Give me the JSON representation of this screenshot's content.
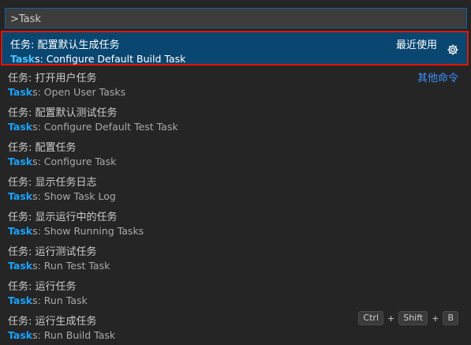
{
  "search": {
    "value": ">Task"
  },
  "items": [
    {
      "line1": "任务: 配置默认生成任务",
      "hl": "Task",
      "rest": "s: Configure Default Build Task",
      "right": "最近使用"
    },
    {
      "line1": "任务: 打开用户任务",
      "hl": "Task",
      "rest": "s: Open User Tasks",
      "right": "其他命令"
    },
    {
      "line1": "任务: 配置默认测试任务",
      "hl": "Task",
      "rest": "s: Configure Default Test Task"
    },
    {
      "line1": "任务: 配置任务",
      "hl": "Task",
      "rest": "s: Configure Task"
    },
    {
      "line1": "任务: 显示任务日志",
      "hl": "Task",
      "rest": "s: Show Task Log"
    },
    {
      "line1": "任务: 显示运行中的任务",
      "hl": "Task",
      "rest": "s: Show Running Tasks"
    },
    {
      "line1": "任务: 运行测试任务",
      "hl": "Task",
      "rest": "s: Run Test Task"
    },
    {
      "line1": "任务: 运行任务",
      "hl": "Task",
      "rest": "s: Run Task"
    },
    {
      "line1": "任务: 运行生成任务",
      "hl": "Task",
      "rest": "s: Run Build Task",
      "keys": [
        "Ctrl",
        "Shift",
        "B"
      ],
      "key_sep": "+"
    }
  ],
  "icons": {
    "configure": "gear-icon"
  },
  "colors": {
    "selection": "#094771",
    "highlight": "#18a3ff",
    "link": "#3794ff",
    "focus_outline": "#e51400"
  }
}
